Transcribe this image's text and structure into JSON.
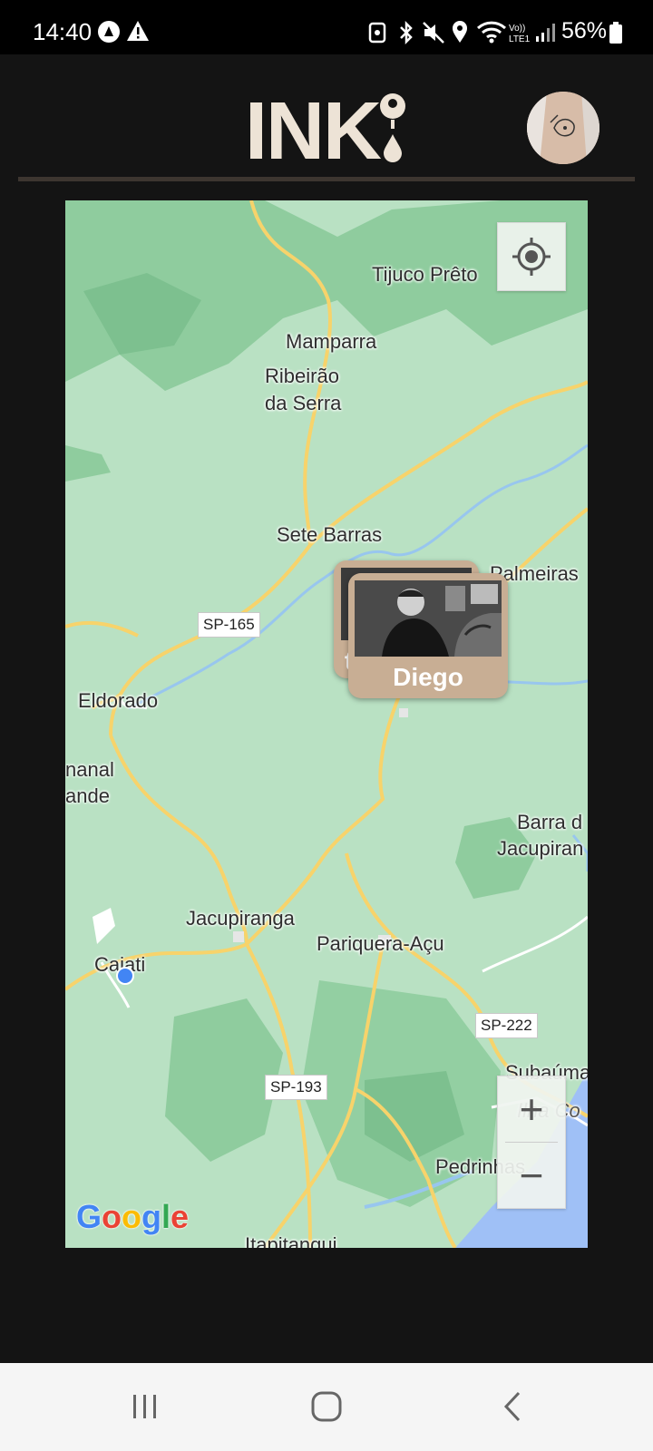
{
  "status_bar": {
    "time": "14:40",
    "battery": "56%"
  },
  "header": {
    "logo_text": "INK"
  },
  "map": {
    "places": {
      "tijuco_preto": "Tijuco Prêto",
      "mamparra": "Mamparra",
      "ribeirao_da_serra_1": "Ribeirão",
      "ribeirao_da_serra_2": "da Serra",
      "sete_barras": "Sete Barras",
      "palmeiras": "Palmeiras",
      "eldorado": "Eldorado",
      "canal_grande_1": "nanal",
      "canal_grande_2": "ande",
      "barra_1": "Barra d",
      "barra_2": "Jacupiran",
      "jacupiranga": "Jacupiranga",
      "pariquera": "Pariquera-Açu",
      "cajati": "Cajati",
      "subauma": "Subaúma",
      "ilha": "Ilha Co",
      "pedrinhas": "Pedrinhas",
      "itapitangui": "Itapitangui"
    },
    "roads": {
      "sp165": "SP-165",
      "sp222": "SP-222",
      "sp193": "SP-193"
    },
    "markers": {
      "back_initial": "t",
      "front_name": "Diego"
    },
    "zoom_in": "+",
    "zoom_out": "−",
    "attribution": {
      "g1": "G",
      "o1": "o",
      "o2": "o",
      "g2": "g",
      "l": "l",
      "e": "e"
    }
  }
}
